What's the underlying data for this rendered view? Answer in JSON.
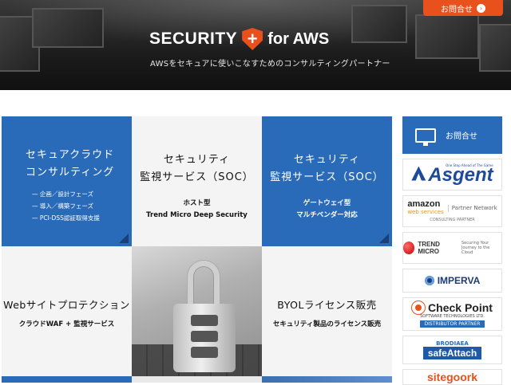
{
  "header": {
    "logo_left": "SECURITY",
    "logo_plus": "+",
    "logo_right": "for AWS",
    "tagline": "AWSをセキュアに使いこなすためのコンサルティングパートナー",
    "contact_button": "お問合せ"
  },
  "tiles": {
    "t1": {
      "title_line1": "セキュアクラウド",
      "title_line2": "コンサルティング",
      "items": [
        "— 企画／設計フェーズ",
        "— 導入／構築フェーズ",
        "— PCI-DSS認証取得支援"
      ]
    },
    "t2": {
      "title_line1": "セキュリティ",
      "title_line2": "監視サービス（SOC）",
      "sub_line1": "ホスト型",
      "sub_line2": "Trend Micro Deep Security"
    },
    "t3": {
      "title_line1": "セキュリティ",
      "title_line2": "監視サービス（SOC）",
      "sub_line1": "ゲートウェイ型",
      "sub_line2": "マルチベンダー対応"
    },
    "t4": {
      "title": "Webサイトプロテクション",
      "sub": "クラウドWAF + 監視サービス"
    },
    "t6": {
      "title": "BYOLライセンス販売",
      "sub": "セキュリティ製品のライセンス販売"
    }
  },
  "sidebar": {
    "contact_label": "お問合せ",
    "banners": {
      "asgent": "Asgent",
      "asgent_small": "One Step Ahead of The Game",
      "amazon": "amazon",
      "aws": "web services",
      "partner_network": "Partner Network",
      "consulting_partner": "CONSULTING PARTNER",
      "trend": "TREND MICRO",
      "trend_tag": "Securing Your Journey to the Cloud",
      "imperva": "IMPERVA",
      "checkpoint": "Check Point",
      "checkpoint_small": "SOFTWARE TECHNOLOGIES LTD.",
      "distributor": "DISTRIBUTOR PARTNER",
      "brodiaea": "BRODIAEA",
      "safeattach": "safeAttach",
      "cut": "sitegoork"
    }
  }
}
